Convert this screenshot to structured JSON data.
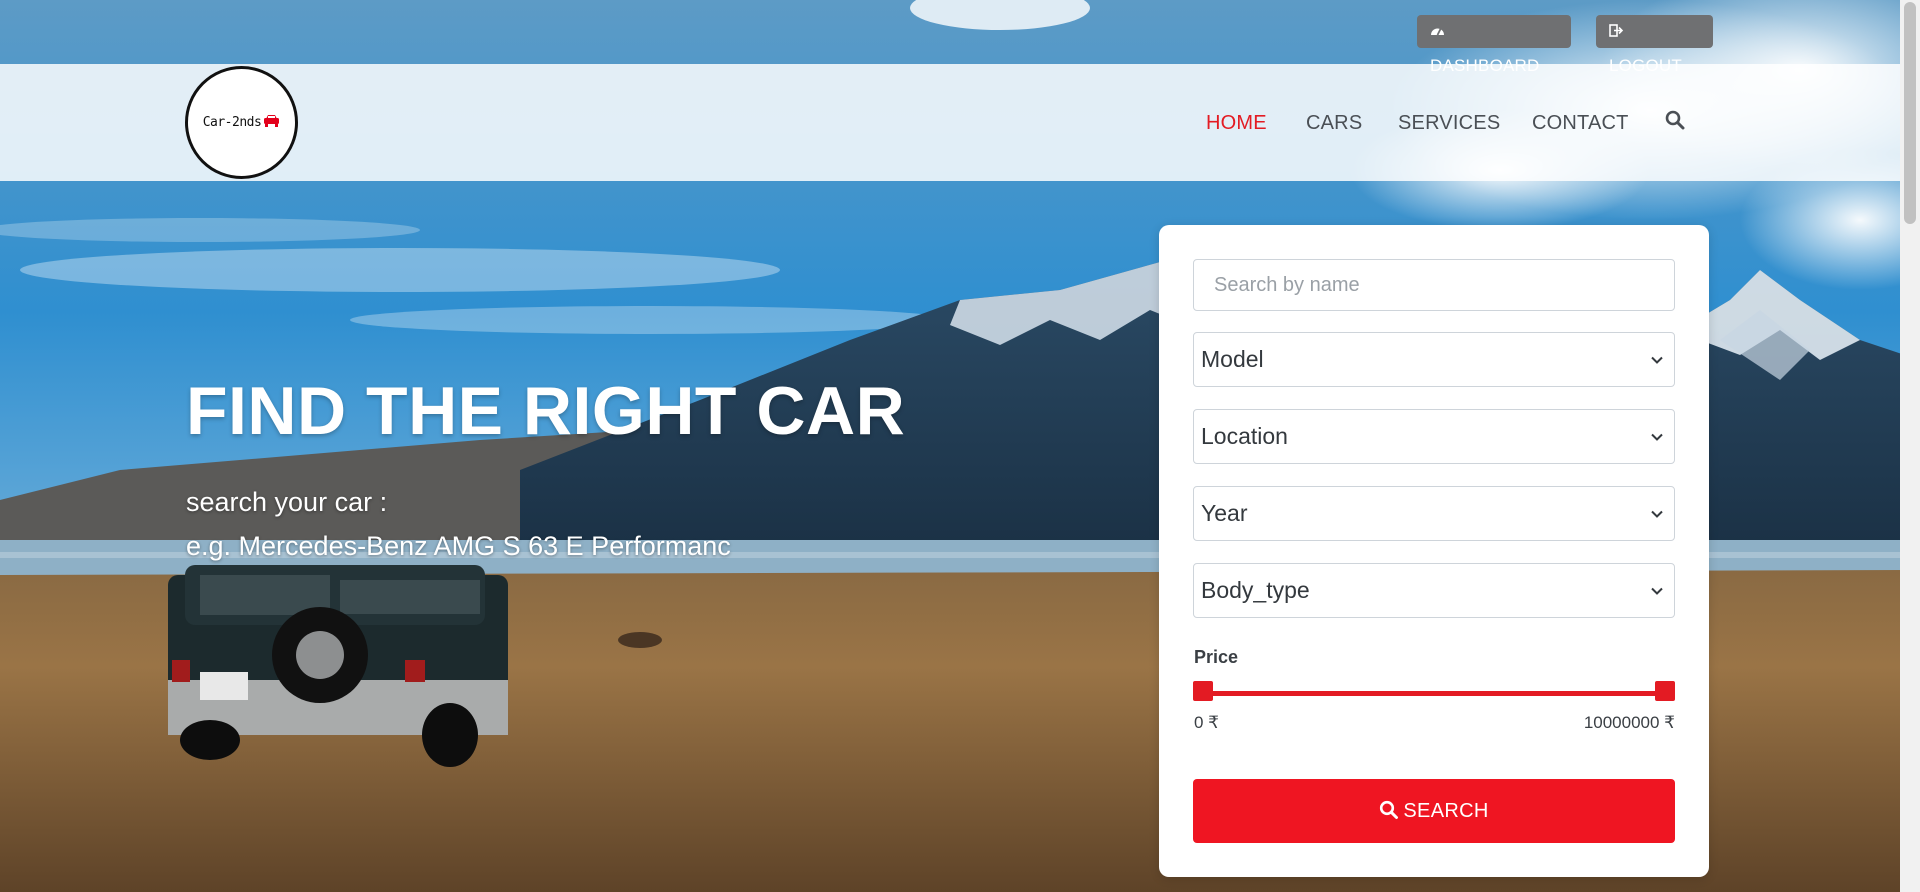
{
  "topbar": {
    "dashboard_label": "DASHBOARD",
    "logout_label": "LOGOUT",
    "dashboard_icon": "speedometer-icon",
    "logout_icon": "sign-out-icon"
  },
  "header": {
    "logo_text": "Car-2nds",
    "logo_icon": "car-icon",
    "nav": {
      "home": "HOME",
      "cars": "CARS",
      "services": "SERVICES",
      "contact": "CONTACT"
    },
    "active_color": "#e31b23"
  },
  "hero": {
    "title": "FIND THE RIGHT CAR",
    "subtitle": "search your car :",
    "example": "e.g. Mercedes-Benz AMG S 63 E Performanc"
  },
  "search_form": {
    "name_placeholder": "Search by name",
    "model": "Model",
    "location": "Location",
    "year": "Year",
    "body_type": "Body_type",
    "price_label": "Price",
    "price_min": "0 ₹",
    "price_max": "10000000 ₹",
    "search_label": "SEARCH",
    "accent_color": "#ef1522"
  }
}
